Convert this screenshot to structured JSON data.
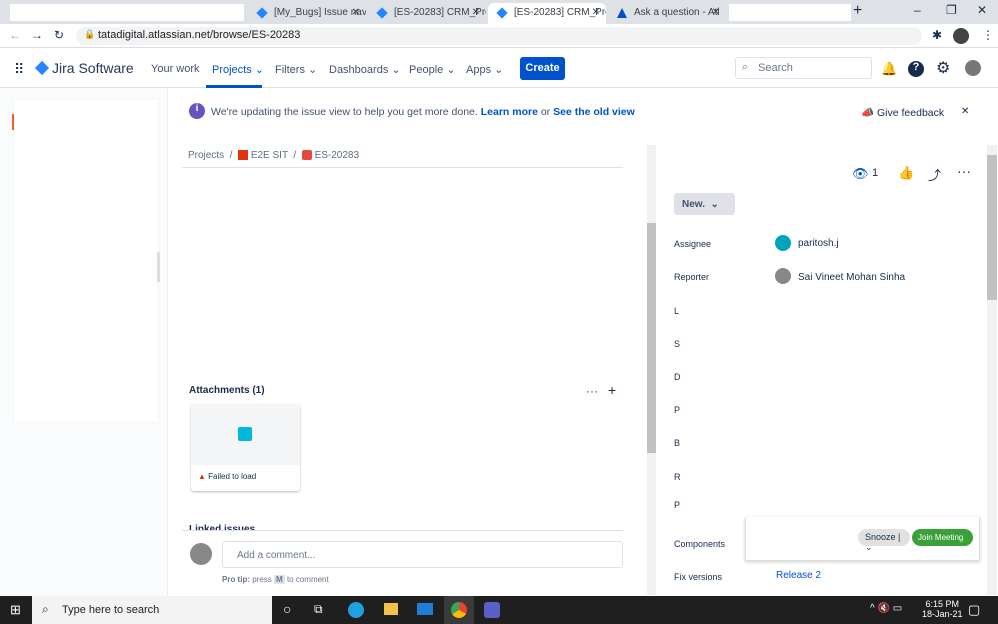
{
  "browser": {
    "tabs": [
      "[My_Bugs] Issue nav",
      "[ES-20283] CRM_Pro",
      "[ES-20283] CRM_Pro",
      "Ask a question - Atl"
    ],
    "url": "tatadigital.atlassian.net/browse/ES-20283"
  },
  "nav": {
    "brand": "Jira Software",
    "items": [
      "Your work",
      "Projects",
      "Filters",
      "Dashboards",
      "People",
      "Apps"
    ],
    "create": "Create",
    "search_placeholder": "Search"
  },
  "banner": {
    "text": "We're updating the issue view to help you get more done.",
    "learn": "Learn more",
    "or": "or",
    "old": "See the old view",
    "feedback": "Give feedback"
  },
  "breadcrumb": {
    "projects": "Projects",
    "project": "E2E SIT",
    "issue": "ES-20283"
  },
  "attachments": {
    "title": "Attachments (1)",
    "error": "Failed to load"
  },
  "linked": "Linked issues",
  "comment": {
    "placeholder": "Add a comment...",
    "tip_label": "Pro tip:",
    "tip_press": "press",
    "tip_key": "M",
    "tip_rest": "to comment"
  },
  "side": {
    "watchers": "1",
    "status": "New.",
    "assignee_label": "Assignee",
    "assignee": "paritosh.j",
    "reporter_label": "Reporter",
    "reporter": "Sai Vineet Mohan Sinha",
    "trunc": [
      "L",
      "S",
      "D",
      "P",
      "B",
      "R",
      "P"
    ],
    "components_label": "Components",
    "fix_label": "Fix versions",
    "fix": "Release 2"
  },
  "popup": {
    "snooze": "Snooze",
    "join": "Join Meeting"
  },
  "taskbar": {
    "search": "Type here to search",
    "time": "6:15 PM",
    "date": "18-Jan-21"
  }
}
